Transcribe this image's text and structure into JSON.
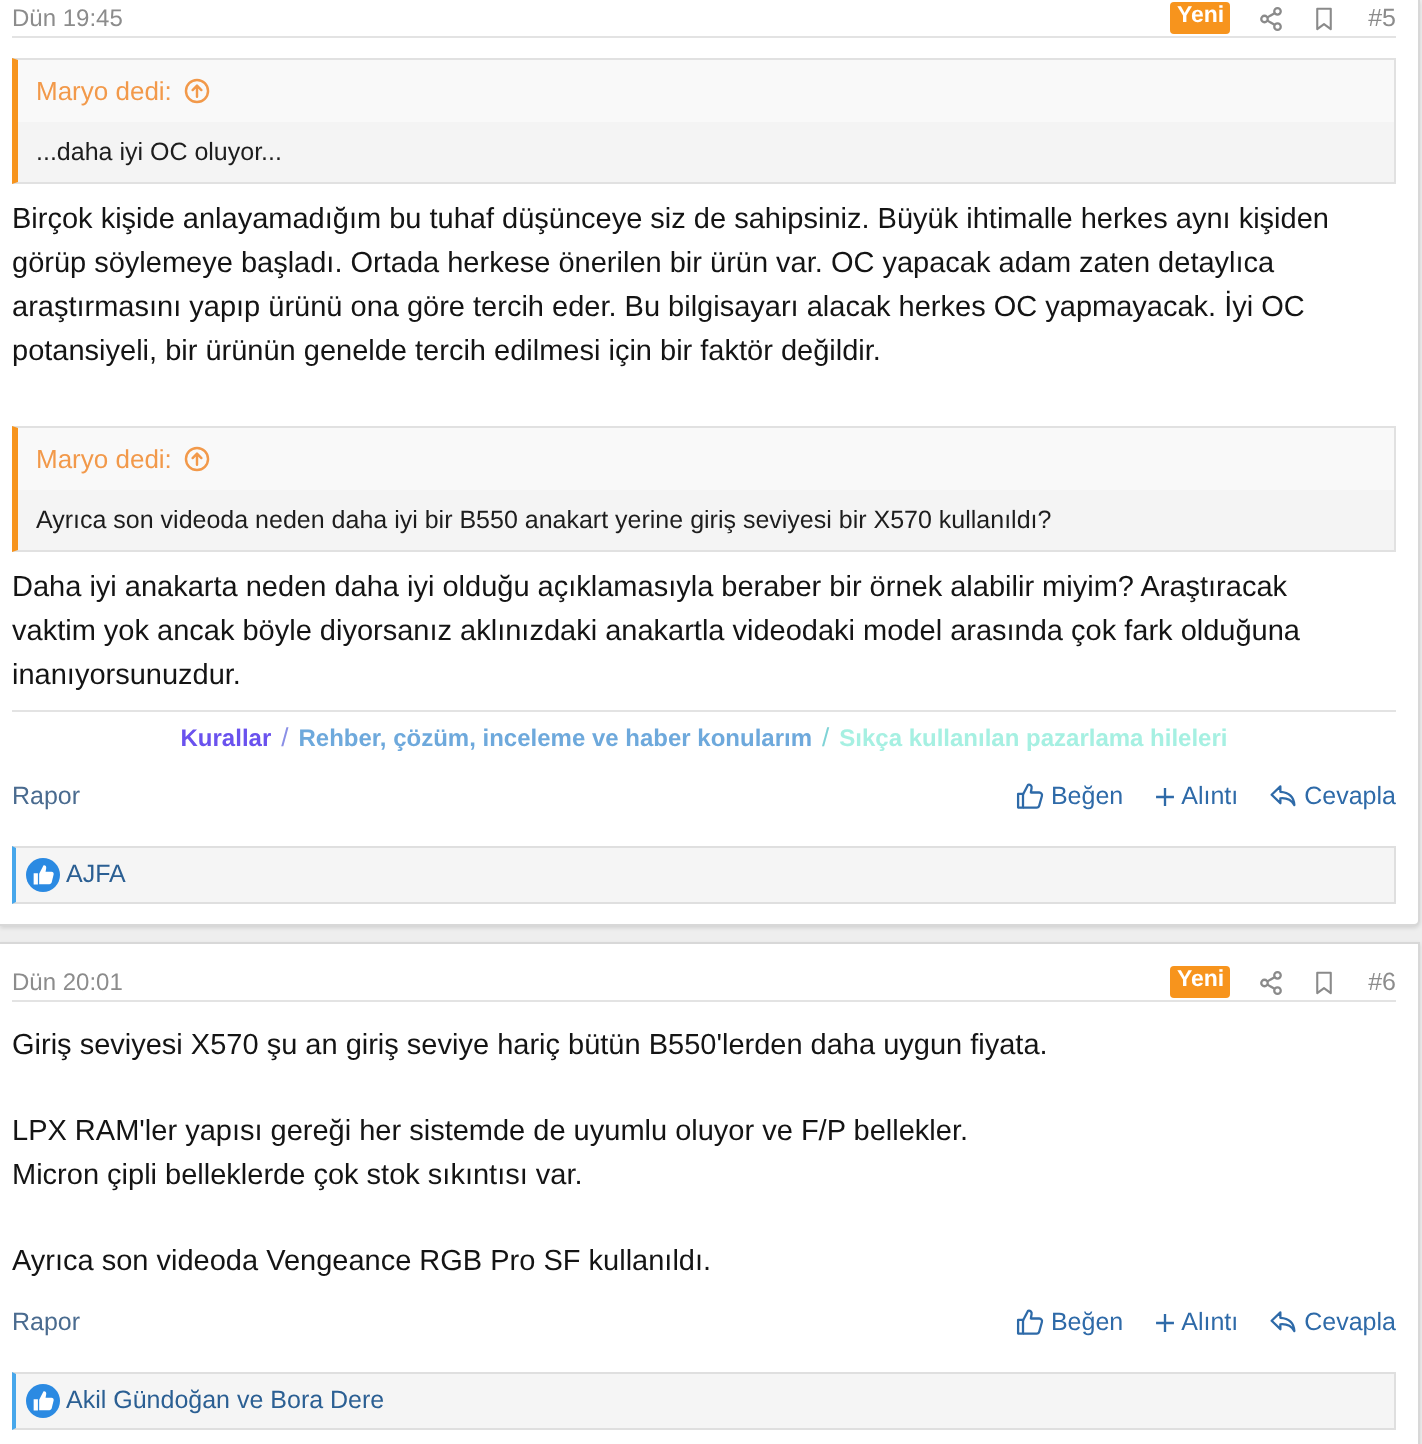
{
  "posts": [
    {
      "date": "Dün 19:45",
      "badge": "Yeni",
      "number": "#5",
      "body": [
        {
          "kind": "quote",
          "author": "Maryo dedi:",
          "text": "...daha iyi OC oluyor..."
        },
        {
          "kind": "paragraph",
          "lines": [
            "Birçok kişide anlayamadığım bu tuhaf düşünceye siz de sahipsiniz. Büyük ihtimalle herkes aynı kişiden görüp söylemeye başladı. Ortada herkese önerilen bir ürün var. OC yapacak adam zaten detaylıca araştırmasını yapıp ürünü ona göre tercih eder. Bu bilgisayarı alacak herkes OC yapmayacak. İyi OC potansiyeli, bir ürünün genelde tercih edilmesi için bir faktör değildir."
          ]
        },
        {
          "kind": "quote",
          "author": "Maryo dedi:",
          "text": "Ayrıca son videoda neden daha iyi bir B550 anakart yerine giriş seviyesi bir X570 kullanıldı?"
        },
        {
          "kind": "paragraph",
          "lines": [
            "Daha iyi anakarta neden daha iyi olduğu açıklamasıyla beraber bir örnek alabilir miyim? Araştıracak vaktim yok ancak böyle diyorsanız aklınızdaki anakartla videodaki model arasında çok fark olduğuna inanıyorsunuzdur."
          ]
        }
      ],
      "signature": [
        {
          "kind": "link",
          "text": "Kurallar",
          "color": "#6a52ee"
        },
        {
          "kind": "separator",
          "text": "/",
          "color": "#8a8fe6"
        },
        {
          "kind": "link",
          "text": "Rehber, çözüm, inceleme ve haber konularım",
          "color": "#6ea9dc"
        },
        {
          "kind": "separator",
          "text": "/",
          "color": "#7fd3d6"
        },
        {
          "kind": "link",
          "text": "Sıkça kullanılan pazarlama hileleri",
          "color": "#a6f0e2"
        }
      ],
      "report": "Rapor",
      "actions": [
        {
          "kind": "like",
          "label": "Beğen"
        },
        {
          "kind": "quote",
          "label": "Alıntı"
        },
        {
          "kind": "reply",
          "label": "Cevapla"
        }
      ],
      "reactions": "AJFA"
    },
    {
      "date": "Dün 20:01",
      "badge": "Yeni",
      "number": "#6",
      "body": [
        {
          "kind": "paragraph",
          "lines": [
            "Giriş seviyesi X570 şu an giriş seviye hariç bütün B550'lerden daha uygun fiyata."
          ]
        },
        {
          "kind": "paragraph",
          "lines": [
            "LPX RAM'ler yapısı gereği her sistemde de uyumlu oluyor ve F/P bellekler.",
            "Micron çipli belleklerde çok stok sıkıntısı var."
          ]
        },
        {
          "kind": "paragraph",
          "lines": [
            "Ayrıca son videoda Vengeance RGB Pro SF kullanıldı."
          ]
        }
      ],
      "report": "Rapor",
      "actions": [
        {
          "kind": "like",
          "label": "Beğen"
        },
        {
          "kind": "quote",
          "label": "Alıntı"
        },
        {
          "kind": "reply",
          "label": "Cevapla"
        }
      ],
      "reactions": "Akil Gündoğan ve Bora Dere"
    }
  ]
}
